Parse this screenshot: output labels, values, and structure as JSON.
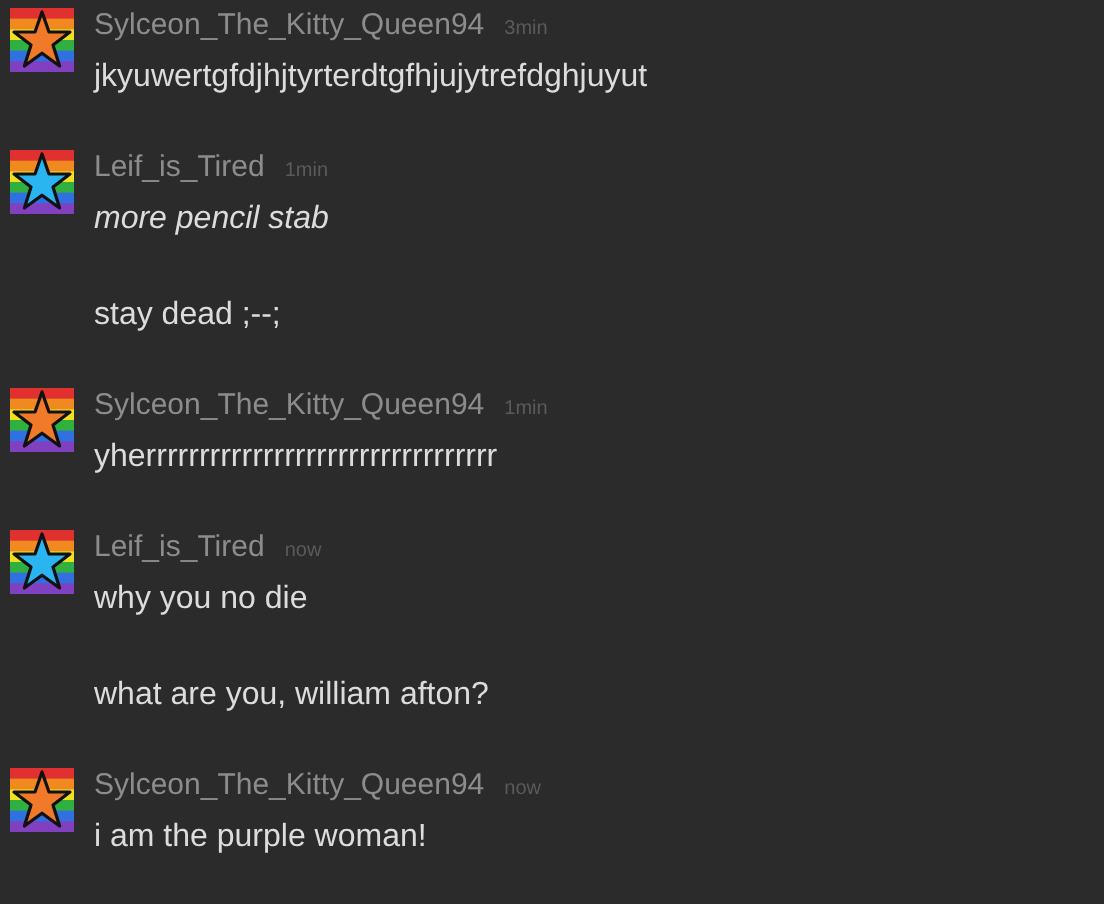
{
  "messages": [
    {
      "username": "Sylceon_The_Kitty_Queen94",
      "time": "3min",
      "color": "#f07a2a",
      "paragraphs": [
        "jkyuwertgfdjhjtyrterdtgfhjujytrefdghjuyut"
      ]
    },
    {
      "username": "Leif_is_Tired",
      "time": "1min",
      "color": "#2ab4f0",
      "paragraphs": [
        "*more pencil stab*",
        "stay dead ;--;"
      ]
    },
    {
      "username": "Sylceon_The_Kitty_Queen94",
      "time": "1min",
      "color": "#f07a2a",
      "paragraphs": [
        "yherrrrrrrrrrrrrrrrrrrrrrrrrrrrrrrrr"
      ]
    },
    {
      "username": "Leif_is_Tired",
      "time": "now",
      "color": "#2ab4f0",
      "paragraphs": [
        "why you no die",
        "what are you, william afton?"
      ]
    },
    {
      "username": "Sylceon_The_Kitty_Queen94",
      "time": "now",
      "color": "#f07a2a",
      "paragraphs": [
        "i am the purple woman!"
      ]
    }
  ]
}
